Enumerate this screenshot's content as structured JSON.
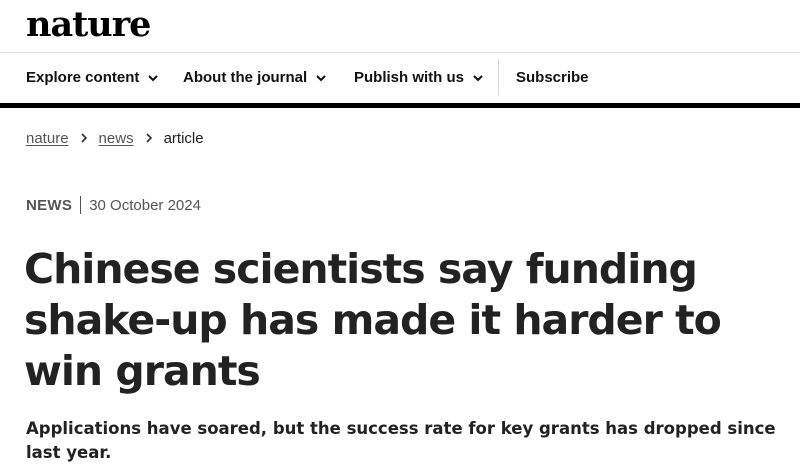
{
  "site": {
    "logo": "nature"
  },
  "nav": {
    "items": [
      {
        "label": "Explore content",
        "has_dropdown": true
      },
      {
        "label": "About the journal",
        "has_dropdown": true
      },
      {
        "label": "Publish with us",
        "has_dropdown": true
      }
    ],
    "subscribe_label": "Subscribe"
  },
  "breadcrumb": {
    "links": [
      {
        "label": "nature"
      },
      {
        "label": "news"
      }
    ],
    "current": "article",
    "separator_icon": "chevron-right-icon"
  },
  "article": {
    "type": "NEWS",
    "date": "30 October 2024",
    "title": "Chinese scientists say funding shake-up has made it harder to win grants",
    "standfirst": "Applications have soared, but the success rate for key grants has dropped since last year."
  },
  "colors": {
    "rule": "#000000",
    "text": "#222222",
    "muted": "#555555"
  }
}
